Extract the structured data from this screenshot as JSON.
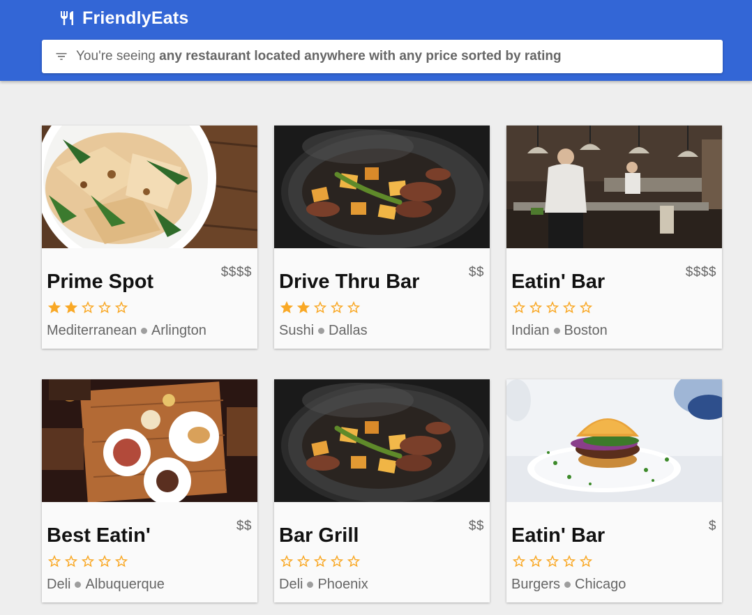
{
  "app": {
    "title": "FriendlyEats",
    "icon": "restaurant-icon",
    "header_color": "#3366d6"
  },
  "filter": {
    "icon": "filter-icon",
    "prefix": "You're seeing",
    "summary": "any restaurant located anywhere with any price sorted by rating"
  },
  "star_color": "#f9a825",
  "restaurants": [
    {
      "name": "Prime Spot",
      "price": "$$$$",
      "rating": 2,
      "category": "Mediterranean",
      "city": "Arlington",
      "image": "pasta-dish-photo"
    },
    {
      "name": "Drive Thru Bar",
      "price": "$$",
      "rating": 2,
      "category": "Sushi",
      "city": "Dallas",
      "image": "sizzling-pan-photo"
    },
    {
      "name": "Eatin' Bar",
      "price": "$$$$",
      "rating": 0,
      "category": "Indian",
      "city": "Boston",
      "image": "restaurant-kitchen-photo"
    },
    {
      "name": "Best Eatin'",
      "price": "$$",
      "rating": 0,
      "category": "Deli",
      "city": "Albuquerque",
      "image": "table-plates-photo"
    },
    {
      "name": "Bar Grill",
      "price": "$$",
      "rating": 0,
      "category": "Deli",
      "city": "Phoenix",
      "image": "sizzling-pan-photo"
    },
    {
      "name": "Eatin' Bar",
      "price": "$",
      "rating": 0,
      "category": "Burgers",
      "city": "Chicago",
      "image": "burger-photo"
    }
  ]
}
